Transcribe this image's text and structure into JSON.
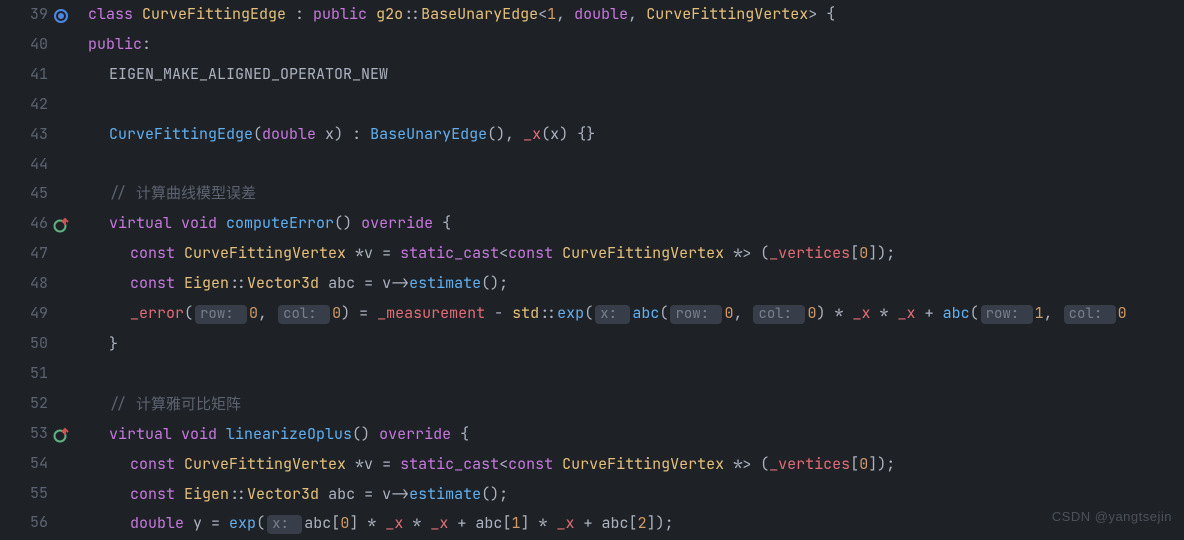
{
  "gutter": {
    "start": 39,
    "end": 56,
    "annotations": {
      "39": "implements-icon",
      "46": "override-up-icon",
      "53": "override-up-icon"
    }
  },
  "hints": {
    "row0": "row: ",
    "col0": "col: ",
    "x": "x: ",
    "row1": "row: "
  },
  "lines": {
    "39": {
      "tokens": [
        {
          "t": "class ",
          "c": "kw"
        },
        {
          "t": "CurveFittingEdge",
          "c": "type"
        },
        {
          "t": " : ",
          "c": "op"
        },
        {
          "t": "public ",
          "c": "kw"
        },
        {
          "t": "g2o",
          "c": "type"
        },
        {
          "t": "::",
          "c": "scope"
        },
        {
          "t": "BaseUnaryEdge",
          "c": "type"
        },
        {
          "t": "<",
          "c": "op"
        },
        {
          "t": "1",
          "c": "num"
        },
        {
          "t": ", ",
          "c": "op"
        },
        {
          "t": "double",
          "c": "kw"
        },
        {
          "t": ", ",
          "c": "op"
        },
        {
          "t": "CurveFittingVertex",
          "c": "type"
        },
        {
          "t": ">",
          "c": "op"
        },
        {
          "t": " {",
          "c": "pun"
        }
      ]
    },
    "40": {
      "tokens": [
        {
          "t": "public",
          "c": "kw"
        },
        {
          "t": ":",
          "c": "pun"
        }
      ]
    },
    "41": {
      "indent": 1,
      "tokens": [
        {
          "t": "EIGEN_MAKE_ALIGNED_OPERATOR_NEW",
          "c": "ident"
        }
      ]
    },
    "42": {
      "tokens": []
    },
    "43": {
      "indent": 1,
      "tokens": [
        {
          "t": "CurveFittingEdge",
          "c": "fn"
        },
        {
          "t": "(",
          "c": "pun"
        },
        {
          "t": "double",
          "c": "kw"
        },
        {
          "t": " x",
          "c": "ident"
        },
        {
          "t": ")",
          "c": "pun"
        },
        {
          "t": " : ",
          "c": "op"
        },
        {
          "t": "BaseUnaryEdge",
          "c": "fn"
        },
        {
          "t": "()",
          "c": "pun"
        },
        {
          "t": ", ",
          "c": "op"
        },
        {
          "t": "_x",
          "c": "field"
        },
        {
          "t": "(",
          "c": "pun"
        },
        {
          "t": "x",
          "c": "ident"
        },
        {
          "t": ")",
          "c": "pun"
        },
        {
          "t": " {}",
          "c": "pun"
        }
      ]
    },
    "44": {
      "tokens": []
    },
    "45": {
      "indent": 1,
      "tokens": [
        {
          "t": "// 计算曲线模型误差",
          "c": "cmt"
        }
      ]
    },
    "46": {
      "indent": 1,
      "tokens": [
        {
          "t": "virtual ",
          "c": "kw"
        },
        {
          "t": "void ",
          "c": "kw"
        },
        {
          "t": "computeError",
          "c": "fn"
        },
        {
          "t": "() ",
          "c": "pun"
        },
        {
          "t": "override",
          "c": "kw"
        },
        {
          "t": " {",
          "c": "pun"
        }
      ]
    },
    "47": {
      "indent": 2,
      "tokens": [
        {
          "t": "const ",
          "c": "kw"
        },
        {
          "t": "CurveFittingVertex ",
          "c": "type"
        },
        {
          "t": "*",
          "c": "op"
        },
        {
          "t": "v",
          "c": "ident"
        },
        {
          "t": " = ",
          "c": "op"
        },
        {
          "t": "static_cast",
          "c": "kw"
        },
        {
          "t": "<",
          "c": "op"
        },
        {
          "t": "const ",
          "c": "kw"
        },
        {
          "t": "CurveFittingVertex ",
          "c": "type"
        },
        {
          "t": "*>",
          "c": "op"
        },
        {
          "t": " (",
          "c": "pun"
        },
        {
          "t": "_vertices",
          "c": "field"
        },
        {
          "t": "[",
          "c": "pun"
        },
        {
          "t": "0",
          "c": "num"
        },
        {
          "t": "]);",
          "c": "pun"
        }
      ]
    },
    "48": {
      "indent": 2,
      "tokens": [
        {
          "t": "const ",
          "c": "kw"
        },
        {
          "t": "Eigen",
          "c": "type"
        },
        {
          "t": "::",
          "c": "scope"
        },
        {
          "t": "Vector3d ",
          "c": "type"
        },
        {
          "t": "abc",
          "c": "ident"
        },
        {
          "t": " = ",
          "c": "op"
        },
        {
          "t": "v",
          "c": "ident"
        },
        {
          "t": "->",
          "c": "op"
        },
        {
          "t": "estimate",
          "c": "fn"
        },
        {
          "t": "();",
          "c": "pun"
        }
      ]
    },
    "49": {
      "indent": 2,
      "tokens": [
        {
          "t": "_error",
          "c": "field"
        },
        {
          "t": "(",
          "c": "pun"
        },
        {
          "hint": "row0"
        },
        {
          "t": "0",
          "c": "num"
        },
        {
          "t": ", ",
          "c": "pun"
        },
        {
          "hint": "col0"
        },
        {
          "t": "0",
          "c": "num"
        },
        {
          "t": ")",
          "c": "pun"
        },
        {
          "t": " = ",
          "c": "op"
        },
        {
          "t": "_measurement",
          "c": "field"
        },
        {
          "t": " - ",
          "c": "op"
        },
        {
          "t": "std",
          "c": "type"
        },
        {
          "t": "::",
          "c": "scope"
        },
        {
          "t": "exp",
          "c": "fn"
        },
        {
          "t": "(",
          "c": "pun"
        },
        {
          "hint": "x"
        },
        {
          "t": "abc",
          "c": "fn"
        },
        {
          "t": "(",
          "c": "pun"
        },
        {
          "hint": "row0"
        },
        {
          "t": "0",
          "c": "num"
        },
        {
          "t": ", ",
          "c": "pun"
        },
        {
          "hint": "col0"
        },
        {
          "t": "0",
          "c": "num"
        },
        {
          "t": ")",
          "c": "pun"
        },
        {
          "t": " * ",
          "c": "op"
        },
        {
          "t": "_x",
          "c": "field"
        },
        {
          "t": " * ",
          "c": "op"
        },
        {
          "t": "_x",
          "c": "field"
        },
        {
          "t": " + ",
          "c": "op"
        },
        {
          "t": "abc",
          "c": "fn"
        },
        {
          "t": "(",
          "c": "pun"
        },
        {
          "hint": "row1"
        },
        {
          "t": "1",
          "c": "num"
        },
        {
          "t": ", ",
          "c": "pun"
        },
        {
          "hint": "col0"
        },
        {
          "t": "0",
          "c": "num"
        }
      ]
    },
    "50": {
      "indent": 1,
      "tokens": [
        {
          "t": "}",
          "c": "pun"
        }
      ]
    },
    "51": {
      "tokens": []
    },
    "52": {
      "indent": 1,
      "tokens": [
        {
          "t": "// 计算雅可比矩阵",
          "c": "cmt"
        }
      ]
    },
    "53": {
      "indent": 1,
      "tokens": [
        {
          "t": "virtual ",
          "c": "kw"
        },
        {
          "t": "void ",
          "c": "kw"
        },
        {
          "t": "linearizeOplus",
          "c": "fn"
        },
        {
          "t": "() ",
          "c": "pun"
        },
        {
          "t": "override",
          "c": "kw"
        },
        {
          "t": " {",
          "c": "pun"
        }
      ]
    },
    "54": {
      "indent": 2,
      "tokens": [
        {
          "t": "const ",
          "c": "kw"
        },
        {
          "t": "CurveFittingVertex ",
          "c": "type"
        },
        {
          "t": "*",
          "c": "op"
        },
        {
          "t": "v",
          "c": "ident"
        },
        {
          "t": " = ",
          "c": "op"
        },
        {
          "t": "static_cast",
          "c": "kw"
        },
        {
          "t": "<",
          "c": "op"
        },
        {
          "t": "const ",
          "c": "kw"
        },
        {
          "t": "CurveFittingVertex ",
          "c": "type"
        },
        {
          "t": "*>",
          "c": "op"
        },
        {
          "t": " (",
          "c": "pun"
        },
        {
          "t": "_vertices",
          "c": "field"
        },
        {
          "t": "[",
          "c": "pun"
        },
        {
          "t": "0",
          "c": "num"
        },
        {
          "t": "]);",
          "c": "pun"
        }
      ]
    },
    "55": {
      "indent": 2,
      "tokens": [
        {
          "t": "const ",
          "c": "kw"
        },
        {
          "t": "Eigen",
          "c": "type"
        },
        {
          "t": "::",
          "c": "scope"
        },
        {
          "t": "Vector3d ",
          "c": "type"
        },
        {
          "t": "abc",
          "c": "ident"
        },
        {
          "t": " = ",
          "c": "op"
        },
        {
          "t": "v",
          "c": "ident"
        },
        {
          "t": "->",
          "c": "op"
        },
        {
          "t": "estimate",
          "c": "fn"
        },
        {
          "t": "();",
          "c": "pun"
        }
      ]
    },
    "56": {
      "indent": 2,
      "tokens": [
        {
          "t": "double ",
          "c": "kw"
        },
        {
          "t": "y",
          "c": "ident"
        },
        {
          "t": " = ",
          "c": "op"
        },
        {
          "t": "exp",
          "c": "fn"
        },
        {
          "t": "(",
          "c": "pun"
        },
        {
          "hint": "x"
        },
        {
          "t": "abc",
          "c": "ident"
        },
        {
          "t": "[",
          "c": "pun"
        },
        {
          "t": "0",
          "c": "num"
        },
        {
          "t": "]",
          "c": "pun"
        },
        {
          "t": " * ",
          "c": "op"
        },
        {
          "t": "_x",
          "c": "field"
        },
        {
          "t": " * ",
          "c": "op"
        },
        {
          "t": "_x",
          "c": "field"
        },
        {
          "t": " + ",
          "c": "op"
        },
        {
          "t": "abc",
          "c": "ident"
        },
        {
          "t": "[",
          "c": "pun"
        },
        {
          "t": "1",
          "c": "num"
        },
        {
          "t": "]",
          "c": "pun"
        },
        {
          "t": " * ",
          "c": "op"
        },
        {
          "t": "_x",
          "c": "field"
        },
        {
          "t": " + ",
          "c": "op"
        },
        {
          "t": "abc",
          "c": "ident"
        },
        {
          "t": "[",
          "c": "pun"
        },
        {
          "t": "2",
          "c": "num"
        },
        {
          "t": "]);",
          "c": "pun"
        }
      ]
    }
  },
  "watermark": {
    "left": "CSDN @yangtsejin"
  }
}
